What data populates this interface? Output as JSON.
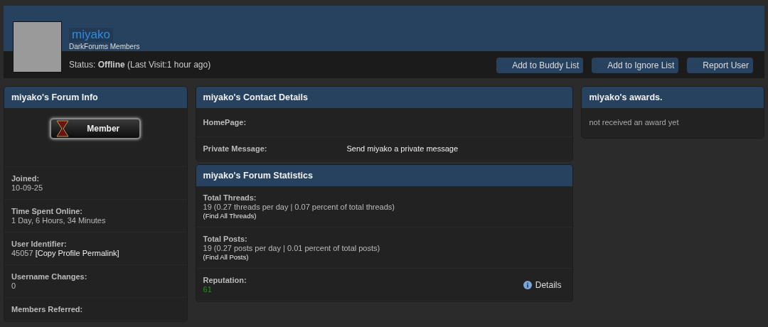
{
  "profile": {
    "username": "miyako",
    "group": "DarkForums Members",
    "status": "Status: **Offline** (Last Visit:1 hour ago)",
    "buttons": [
      "Add to Buddy List",
      "Add to Ignore List",
      "Report User"
    ]
  },
  "forum_info": {
    "title": "miyako's Forum Info",
    "rank_badge": "Member",
    "rows": [
      {
        "label": "Joined:",
        "value": "10-09-25"
      },
      {
        "label": "Time Spent Online:",
        "value": "1 Day, 6 Hours, 34 Minutes"
      },
      {
        "label": "User Identifier:",
        "value": "45057",
        "link": "[Copy Profile Permalink]"
      },
      {
        "label": "Username Changes:",
        "value": "0"
      },
      {
        "label": "Members Referred:"
      }
    ]
  },
  "contact": {
    "title": "miyako's Contact Details",
    "rows": [
      {
        "label": "HomePage:"
      },
      {
        "label": "Private Message:",
        "link": "Send miyako a private message"
      }
    ]
  },
  "statistics": {
    "title": "miyako's Forum Statistics",
    "rows": [
      {
        "label": "Total Threads:",
        "value": "19 (0.27 threads per day | 0.07 percent of total threads)",
        "link": "(Find All Threads)"
      },
      {
        "label": "Total Posts:",
        "value": "19 (0.27 posts per day | 0.01 percent of total posts)",
        "link": "(Find All Posts)"
      }
    ],
    "reputation": {
      "label": "Reputation:",
      "value": "61",
      "details": "Details"
    }
  },
  "awards": {
    "title": "miyako's awards.",
    "text": "not received an award yet"
  }
}
